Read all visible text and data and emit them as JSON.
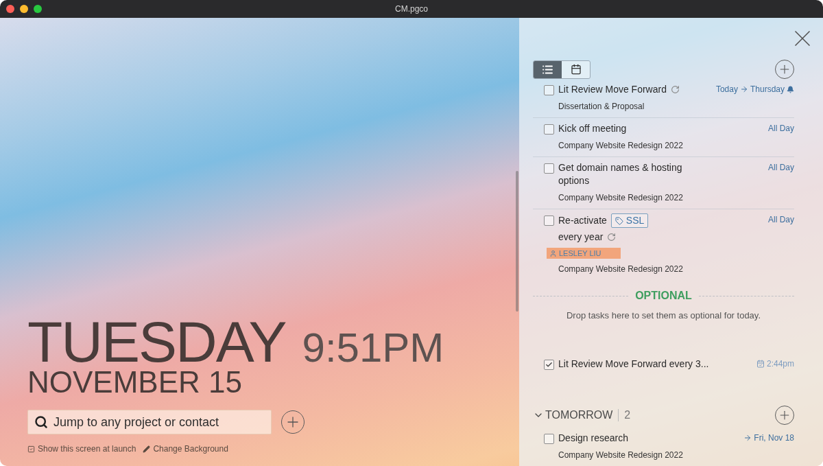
{
  "window": {
    "title": "CM.pgco"
  },
  "clock": {
    "day": "TUESDAY",
    "time": "9:51PM",
    "date": "NOVEMBER 15"
  },
  "search": {
    "placeholder": "Jump to any project or contact"
  },
  "footer": {
    "show_at_launch": {
      "label": "Show this screen at launch",
      "checked": true
    },
    "change_background": "Change Background"
  },
  "view_toggle": [
    {
      "kind": "list",
      "selected": true
    },
    {
      "kind": "calendar",
      "selected": false
    }
  ],
  "today_tasks": [
    {
      "title": "Lit Review Move Forward",
      "checked": false,
      "recurring": true,
      "due": {
        "kind": "range",
        "from": "Today",
        "to": "Thursday"
      },
      "reminder": true,
      "project": "Dissertation & Proposal"
    },
    {
      "title": "Kick off meeting",
      "checked": false,
      "due": {
        "kind": "text",
        "text": "All Day"
      },
      "project": "Company Website Redesign 2022"
    },
    {
      "title": "Get domain names & hosting options",
      "checked": false,
      "due": {
        "kind": "text",
        "text": "All Day"
      },
      "project": "Company Website Redesign 2022"
    },
    {
      "title": "Re-activate",
      "tag": "SSL",
      "title_end": "every year",
      "checked": false,
      "recurring": true,
      "due": {
        "kind": "text",
        "text": "All Day"
      },
      "assignee": "LESLEY LIU",
      "project": "Company Website Redesign 2022"
    }
  ],
  "optional": {
    "title": "OPTIONAL",
    "hint": "Drop tasks here to set them as optional for today.",
    "tasks": [
      {
        "title": "Lit Review Move Forward every 3...",
        "checked": true,
        "due": {
          "kind": "time",
          "text": "2:44pm"
        }
      }
    ]
  },
  "tomorrow": {
    "title": "TOMORROW",
    "count": "2",
    "expanded": true,
    "tasks": [
      {
        "title": "Design research",
        "checked": false,
        "due": {
          "kind": "moved",
          "to": "Fri, Nov 18"
        },
        "project": "Company Website Redesign 2022"
      }
    ]
  }
}
